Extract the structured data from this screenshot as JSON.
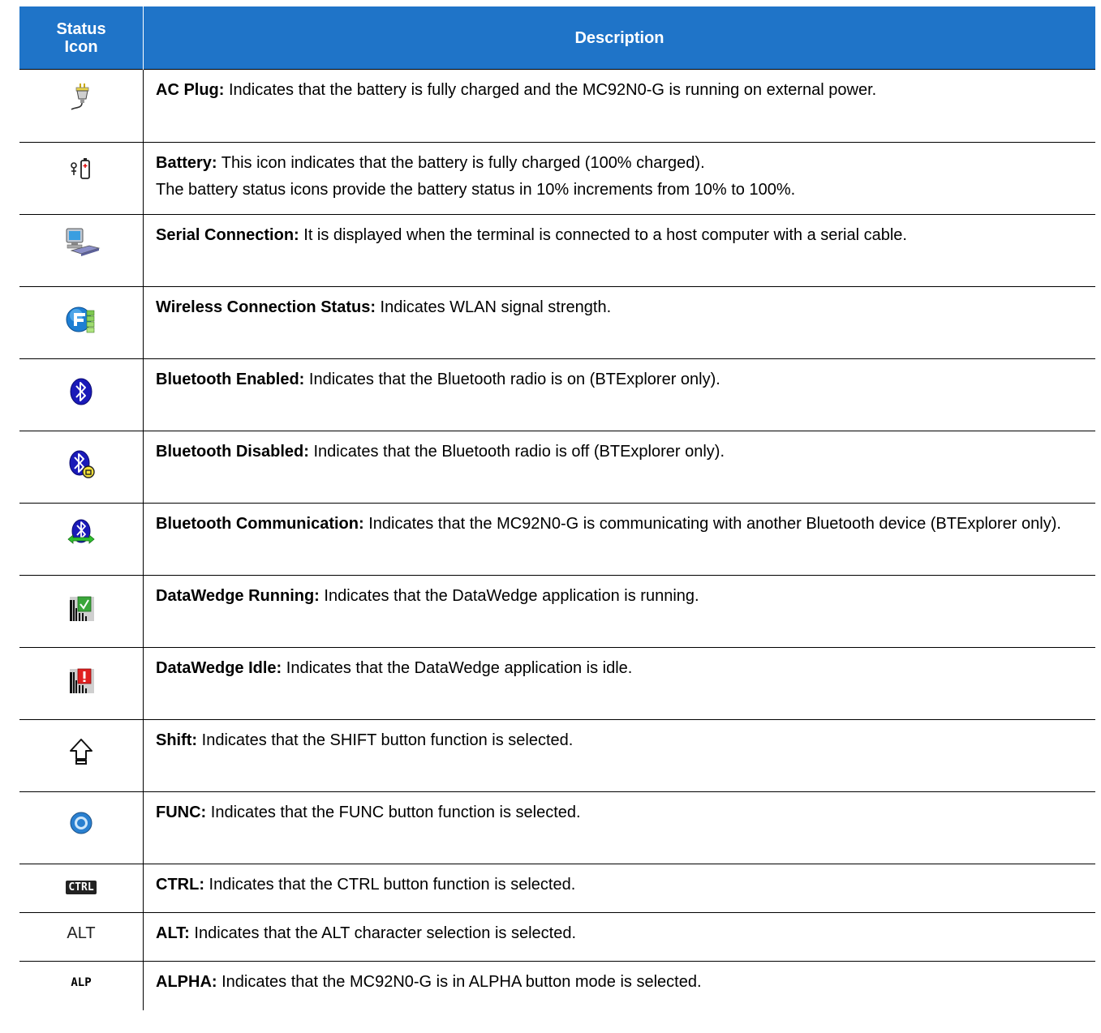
{
  "header": {
    "col1_line1": "Status",
    "col1_line2": "Icon",
    "col2": "Description"
  },
  "rows": [
    {
      "icon": "ac-plug-icon",
      "term": "AC Plug:",
      "text": " Indicates that the battery is fully charged and the MC92N0-G is running on external power.",
      "extra": ""
    },
    {
      "icon": "battery-icon",
      "term": "Battery:",
      "text": " This icon indicates that the battery is fully charged (100% charged).",
      "extra": "The battery status icons provide the battery status in 10% increments from 10% to 100%."
    },
    {
      "icon": "serial-connection-icon",
      "term": "Serial Connection:",
      "text": " It is displayed when the terminal is connected to a host computer with a serial cable.",
      "extra": ""
    },
    {
      "icon": "wireless-connection-icon",
      "term": "Wireless Connection Status:",
      "text": " Indicates WLAN signal strength.",
      "extra": ""
    },
    {
      "icon": "bluetooth-enabled-icon",
      "term": "Bluetooth Enabled:",
      "text": " Indicates that the Bluetooth radio is on (BTExplorer only).",
      "extra": ""
    },
    {
      "icon": "bluetooth-disabled-icon",
      "term": "Bluetooth Disabled:",
      "text": " Indicates that the Bluetooth radio is off (BTExplorer only).",
      "extra": ""
    },
    {
      "icon": "bluetooth-communication-icon",
      "term": "Bluetooth Communication:",
      "text": " Indicates that the MC92N0-G is communicating with another Bluetooth device (BTExplorer only).",
      "extra": ""
    },
    {
      "icon": "datawedge-running-icon",
      "term": "DataWedge Running:",
      "text": " Indicates that the DataWedge application is running.",
      "extra": ""
    },
    {
      "icon": "datawedge-idle-icon",
      "term": "DataWedge Idle:",
      "text": " Indicates that the DataWedge application is idle.",
      "extra": ""
    },
    {
      "icon": "shift-icon",
      "term": "Shift:",
      "text": " Indicates that the SHIFT button function is selected.",
      "extra": ""
    },
    {
      "icon": "func-icon",
      "term": "FUNC:",
      "text": " Indicates that the FUNC button function is selected.",
      "extra": ""
    },
    {
      "icon": "ctrl-icon",
      "icon_text": "CTRL",
      "term": "CTRL:",
      "text": " Indicates that the CTRL button function is selected.",
      "extra": ""
    },
    {
      "icon": "alt-icon",
      "icon_text": "ALT",
      "term": "ALT:",
      "text": " Indicates that the ALT character selection is selected.",
      "extra": ""
    },
    {
      "icon": "alp-icon",
      "icon_text": "ALP",
      "term": "ALPHA:",
      "text": " Indicates that the MC92N0-G is in ALPHA button mode is selected.",
      "extra": ""
    }
  ]
}
